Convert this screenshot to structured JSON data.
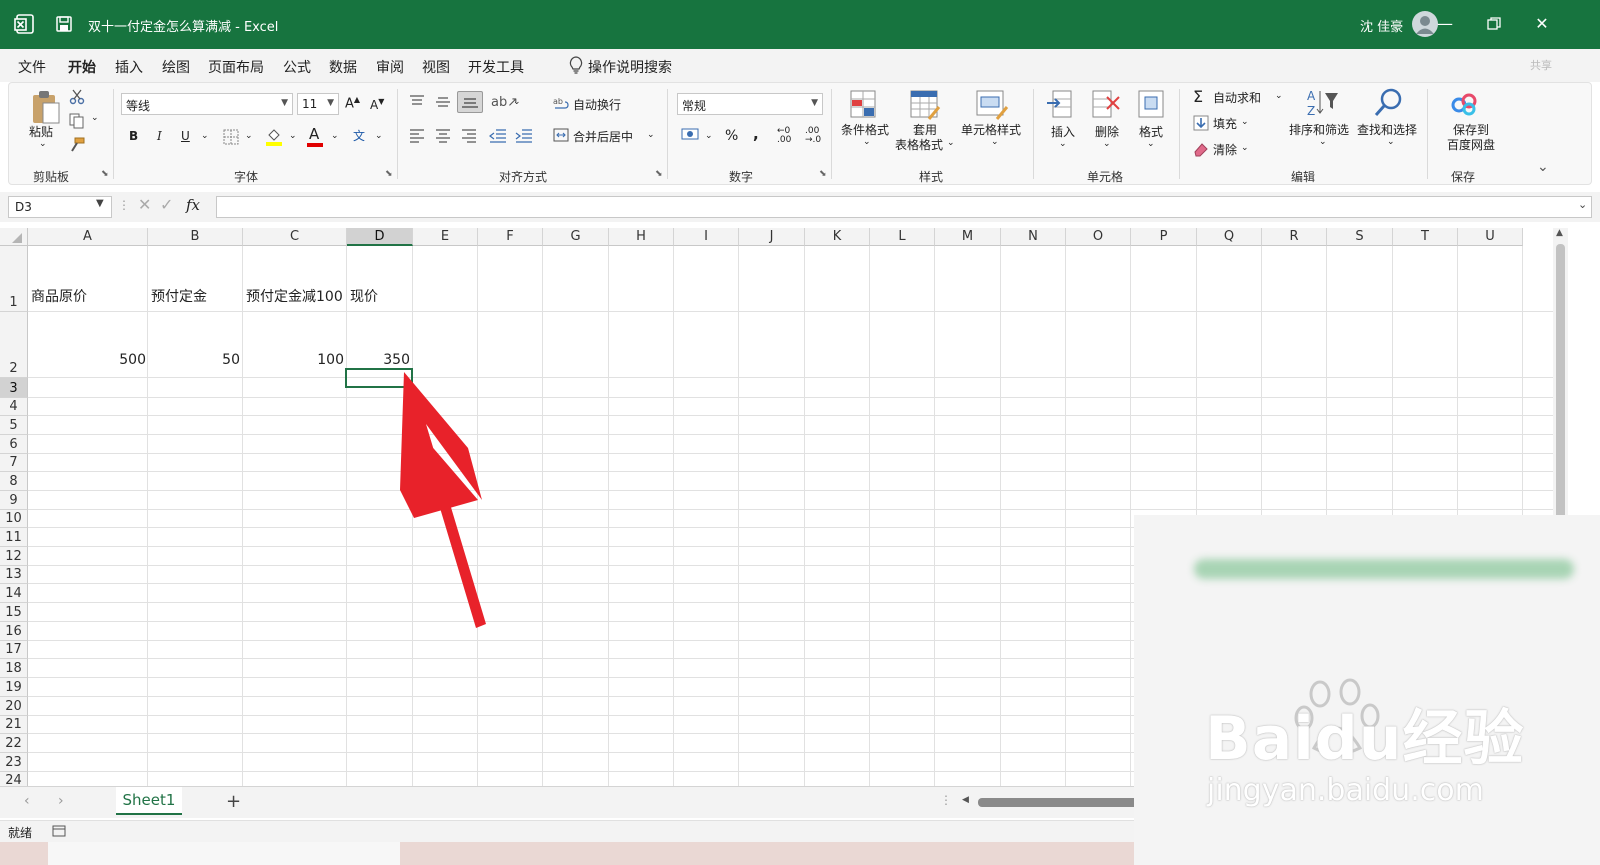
{
  "window": {
    "title": "双十一付定金怎么算满减 - Excel",
    "user": "沈 佳豪",
    "colors": {
      "brand": "#17743f",
      "selection": "#217346"
    }
  },
  "menu": {
    "tabs": [
      "文件",
      "开始",
      "插入",
      "绘图",
      "页面布局",
      "公式",
      "数据",
      "审阅",
      "视图",
      "开发工具"
    ],
    "active": "开始",
    "search_label": "操作说明搜索",
    "share": "共享"
  },
  "ribbon": {
    "clipboard": {
      "paste": "粘贴",
      "label": "剪贴板"
    },
    "font": {
      "name": "等线",
      "size": "11",
      "bold": "B",
      "italic": "I",
      "underline": "U",
      "label": "字体",
      "grow": "A",
      "shrink": "A",
      "phonetic": "文",
      "font_color_glyph": "A"
    },
    "alignment": {
      "wrap": "自动换行",
      "merge": "合并后居中",
      "label": "对齐方式"
    },
    "number": {
      "format": "常规",
      "percent": "%",
      "comma": ",",
      "label": "数字"
    },
    "styles": {
      "conditional": "条件格式",
      "table_line1": "套用",
      "table_line2": "表格格式",
      "cell_styles": "单元格样式",
      "label": "样式"
    },
    "cells": {
      "insert": "插入",
      "delete": "删除",
      "format": "格式",
      "label": "单元格"
    },
    "editing": {
      "autosum": "自动求和",
      "fill": "填充",
      "clear": "清除",
      "sort": "排序和筛选",
      "find": "查找和选择",
      "label": "编辑"
    },
    "save": {
      "line1": "保存到",
      "line2": "百度网盘",
      "label": "保存"
    }
  },
  "formula_bar": {
    "name_box": "D3",
    "fx": "fx",
    "formula": ""
  },
  "sheet": {
    "columns": [
      "A",
      "B",
      "C",
      "D",
      "E",
      "F",
      "G",
      "H",
      "I",
      "J",
      "K",
      "L",
      "M",
      "N",
      "O",
      "P",
      "Q",
      "R",
      "S",
      "T",
      "U"
    ],
    "rows": [
      "1",
      "2",
      "3",
      "4",
      "5",
      "6",
      "7",
      "8",
      "9",
      "10",
      "11",
      "12",
      "13",
      "14",
      "15",
      "16",
      "17",
      "18",
      "19",
      "20",
      "21",
      "22",
      "23",
      "24"
    ],
    "selected_cell": "D3",
    "cells": {
      "A1": "商品原价",
      "B1": "预付定金",
      "C1": "预付定金减100",
      "D1": "现价",
      "A2": "500",
      "B2": "50",
      "C2": "100",
      "D2": "350"
    }
  },
  "tabs_bar": {
    "sheet_name": "Sheet1",
    "add": "+"
  },
  "status": {
    "ready": "就绪"
  },
  "watermark": {
    "brand": "Baidu经验",
    "url": "jingyan.baidu.com"
  },
  "annotation": {
    "arrow_color": "#e8222a"
  }
}
